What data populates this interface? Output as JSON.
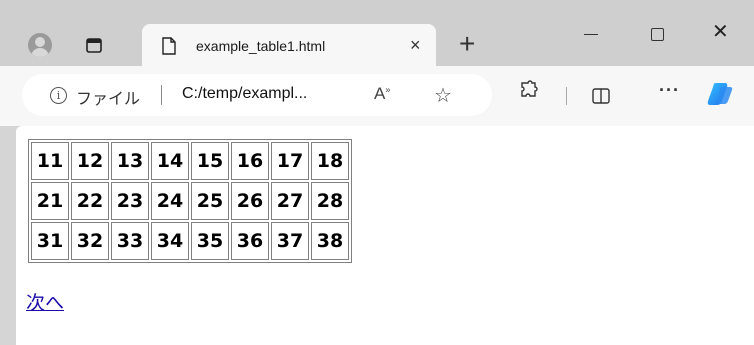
{
  "browser": {
    "tab": {
      "title": "example_table1.html",
      "close": "×"
    },
    "new_tab": "+",
    "window": {
      "close": "✕"
    },
    "address": {
      "info_icon": "i",
      "file_label": "ファイル",
      "url": "C:/temp/exampl..."
    },
    "toolbar": {
      "read_aloud": "A",
      "read_aloud_sup": "»",
      "favorite": "☆",
      "more": "···"
    }
  },
  "page": {
    "table": {
      "rows": [
        [
          "11",
          "12",
          "13",
          "14",
          "15",
          "16",
          "17",
          "18"
        ],
        [
          "21",
          "22",
          "23",
          "24",
          "25",
          "26",
          "27",
          "28"
        ],
        [
          "31",
          "32",
          "33",
          "34",
          "35",
          "36",
          "37",
          "38"
        ]
      ]
    },
    "next_link": "次へ"
  },
  "colors": {
    "titlebar": "#cfcfcf",
    "toolbar": "#f7f7f7",
    "link": "#1a0dab",
    "copilot_a": "#1f6feb",
    "copilot_b": "#35c2ff"
  }
}
